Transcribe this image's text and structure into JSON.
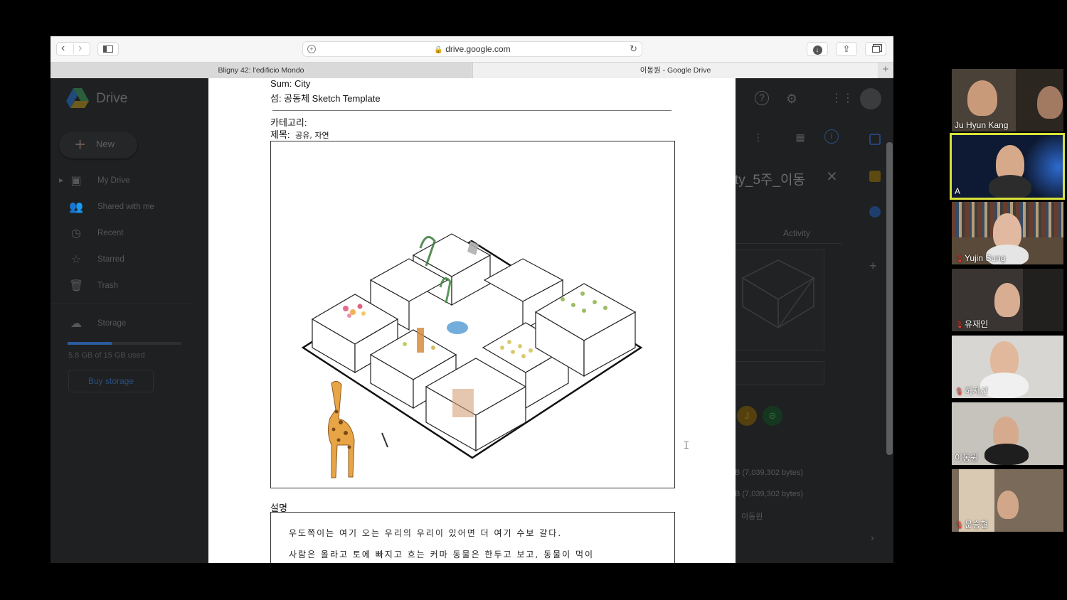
{
  "browser": {
    "url": "drive.google.com",
    "tabs": [
      {
        "label": "Bligny 42: l'edificio Mondo"
      },
      {
        "label": "이동원 - Google Drive"
      }
    ],
    "new_tab": "+"
  },
  "drive": {
    "app_name": "Drive",
    "new_button": "New",
    "nav": [
      {
        "label": "My Drive",
        "icon": "my-drive-icon"
      },
      {
        "label": "Shared with me",
        "icon": "people-icon"
      },
      {
        "label": "Recent",
        "icon": "clock-icon"
      },
      {
        "label": "Starred",
        "icon": "star-icon"
      },
      {
        "label": "Trash",
        "icon": "trash-icon"
      }
    ],
    "storage_label": "Storage",
    "storage_used": "5.8 GB of 15 GB used",
    "storage_fraction": 0.39,
    "buy_storage": "Buy storage",
    "details": {
      "title": "ty_5주_이동",
      "activity_tab": "Activity",
      "chip_letter": "J",
      "size_1": "B (7,039,302 bytes)",
      "size_2": "B (7,039,302 bytes)",
      "owner": "이동원"
    }
  },
  "document": {
    "sum": "Sum: City",
    "subtitle": "섬: 공동체 Sketch Template",
    "category": "카테고리:",
    "title_label": "제목:",
    "title_handwritten": "공유, 자연",
    "description_label": "설명",
    "handwriting_line1": "우도쪽이는 여기 오는 우리의 우리이 있어면 더 여기 수보 갈다.",
    "handwriting_line2": "사람은 올라고 토에 빠지고 흐는 커마 동물은 한두고 보고, 동물이 먹이"
  },
  "participants": [
    {
      "name": "Ju Hyun Kang",
      "muted": false,
      "active": false
    },
    {
      "name": "A",
      "muted": false,
      "active": true
    },
    {
      "name": "Yujin Sung",
      "muted": true,
      "active": false
    },
    {
      "name": "유재인",
      "muted": true,
      "active": false
    },
    {
      "name": "허지선",
      "muted": true,
      "active": false
    },
    {
      "name": "이동원",
      "muted": false,
      "active": false
    },
    {
      "name": "문승현",
      "muted": true,
      "active": false
    }
  ],
  "colors": {
    "active_speaker_border": "#d8e23a",
    "muted_mic": "#ff3b30"
  }
}
